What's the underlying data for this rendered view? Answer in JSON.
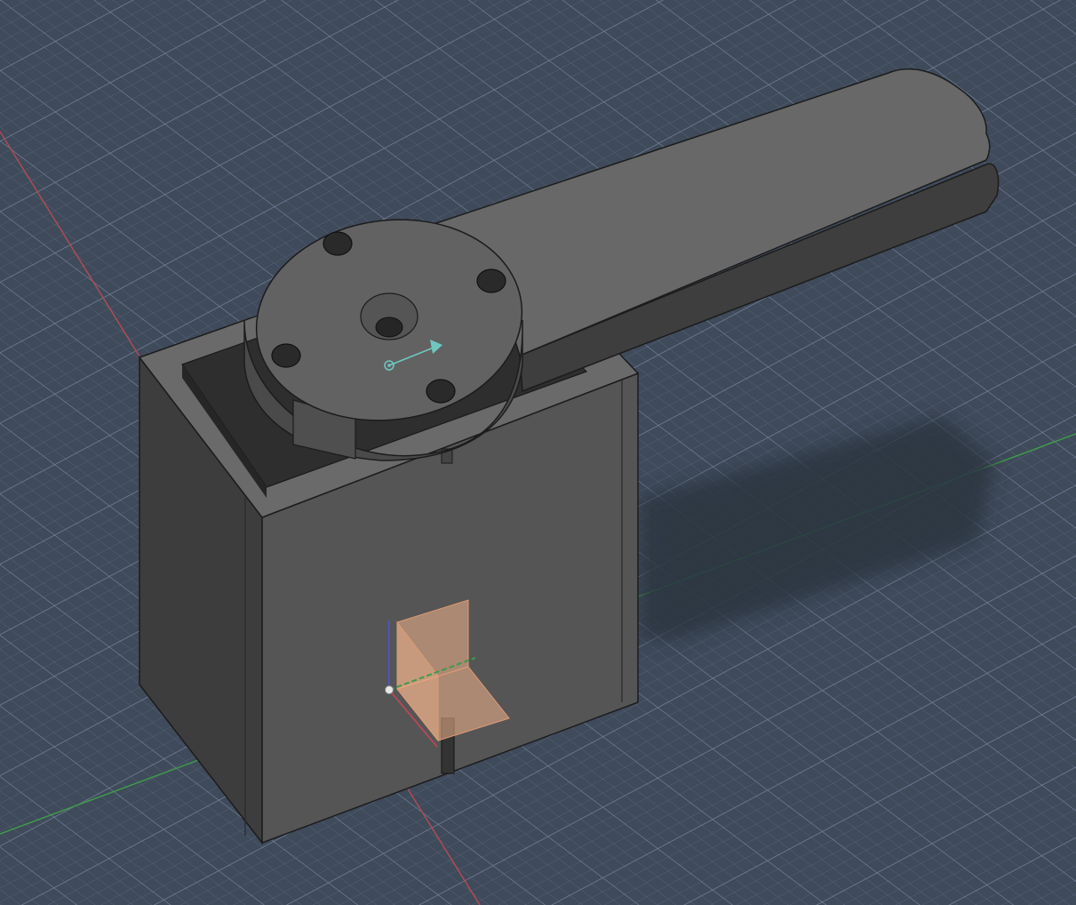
{
  "viewport": {
    "background_color": "#3f4a5a",
    "grid_minor_color": "#56627a",
    "grid_major_color": "#76839a",
    "axis_x_color": "#b04a58",
    "axis_y_color": "#3f9a4a",
    "axis_z_color": "#4a55c8"
  },
  "model": {
    "body_color": "#4f4f4f",
    "top_color": "#686868",
    "side_color": "#3a3a3a",
    "edge_color": "#1c1c1c",
    "shadow_color": "#2e3744"
  },
  "origin_gizmo": {
    "plane_color": "#f2b48c",
    "icon": "origin-planes-icon"
  },
  "joint_marker": {
    "color": "#6fc8c0",
    "icon": "joint-direction-icon"
  }
}
